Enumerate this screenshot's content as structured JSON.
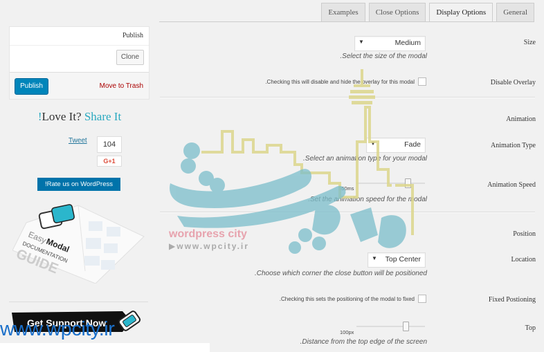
{
  "tabs": [
    {
      "label": "Examples",
      "active": false
    },
    {
      "label": "Close Options",
      "active": false
    },
    {
      "label": "Display Options",
      "active": true
    },
    {
      "label": "General",
      "active": false
    }
  ],
  "publish_box": {
    "title": "Publish",
    "clone_label": "Clone",
    "publish_label": "Publish",
    "trash_label": "Move to Trash"
  },
  "share": {
    "bang": "!",
    "love": "Love It? ",
    "share": "Share It",
    "tweet_label": "Tweet",
    "count": "104",
    "gplus_label": "G+1",
    "rate_label": "!Rate us on WordPress"
  },
  "guide": {
    "brand_easy": "Easy",
    "brand_modal": "Modal",
    "line1": "DOCUMENTATION",
    "line2": "GUIDE"
  },
  "support": {
    "label": "Get Support Now"
  },
  "watermark": {
    "url_big": "www.wpcity.ir",
    "brand": "wordpress city",
    "url_small": "▶www.wpcity.ir"
  },
  "colors": {
    "primary": "#0085ba",
    "link": "#21759b",
    "danger": "#a00",
    "accent": "#2aa9c0"
  },
  "form": {
    "size": {
      "label": "Size",
      "value": "Medium",
      "description": ".Select the size of the modal"
    },
    "disable_overlay": {
      "label": "Disable Overlay",
      "description": ".Checking this will disable and hide the overlay for this modal",
      "checked": false
    },
    "animation_section": "Animation",
    "animation_type": {
      "label": "Animation Type",
      "value": "Fade",
      "description": ".Select an animation type for your modal"
    },
    "animation_speed": {
      "label": "Animation Speed",
      "value": "350ms",
      "fraction": 0.75,
      "description": ".Set the animation speed for the modal"
    },
    "position_section": "Position",
    "location": {
      "label": "Location",
      "value": "Top Center",
      "description": ".Choose which corner the close button will be positioned"
    },
    "fixed_positioning": {
      "label": "Fixed Postioning",
      "description": ".Checking this sets the positioning of the modal to fixed",
      "checked": false
    },
    "top": {
      "label": "Top",
      "value": "100px",
      "fraction": 0.72,
      "description": ".Distance from the top edge of the screen"
    }
  }
}
